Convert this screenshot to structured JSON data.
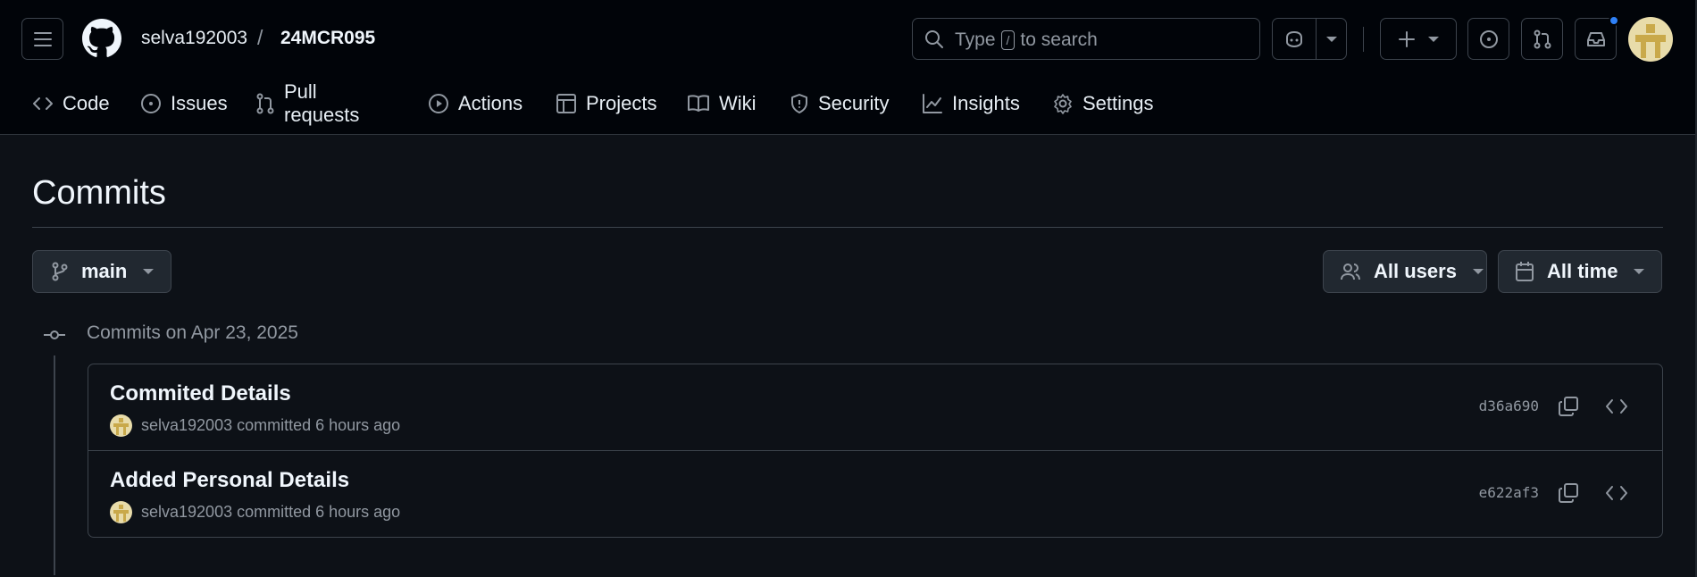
{
  "header": {
    "owner": "selva192003",
    "separator": "/",
    "repo": "24MCR095",
    "search": {
      "prefix": "Type",
      "key": "/",
      "suffix": "to search"
    }
  },
  "nav": {
    "tabs": [
      {
        "label": "Code",
        "icon": "code-icon"
      },
      {
        "label": "Issues",
        "icon": "issue-icon"
      },
      {
        "label": "Pull requests",
        "icon": "pull-request-icon"
      },
      {
        "label": "Actions",
        "icon": "play-icon"
      },
      {
        "label": "Projects",
        "icon": "table-icon"
      },
      {
        "label": "Wiki",
        "icon": "book-icon"
      },
      {
        "label": "Security",
        "icon": "shield-icon"
      },
      {
        "label": "Insights",
        "icon": "graph-icon"
      },
      {
        "label": "Settings",
        "icon": "gear-icon"
      }
    ]
  },
  "page": {
    "title": "Commits",
    "branch": "main",
    "users_filter": "All users",
    "time_filter": "All time"
  },
  "group": {
    "label": "Commits on Apr 23, 2025",
    "commits": [
      {
        "title": "Commited Details",
        "author": "selva192003",
        "when": "committed 6 hours ago",
        "sha": "d36a690"
      },
      {
        "title": "Added Personal Details",
        "author": "selva192003",
        "when": "committed 6 hours ago",
        "sha": "e622af3"
      }
    ]
  },
  "colors": {
    "header_bg": "#010409",
    "page_bg": "#0d1117",
    "border": "#3d444d",
    "notification_dot": "#2f81f7",
    "avatar": "#e8dcaa"
  }
}
